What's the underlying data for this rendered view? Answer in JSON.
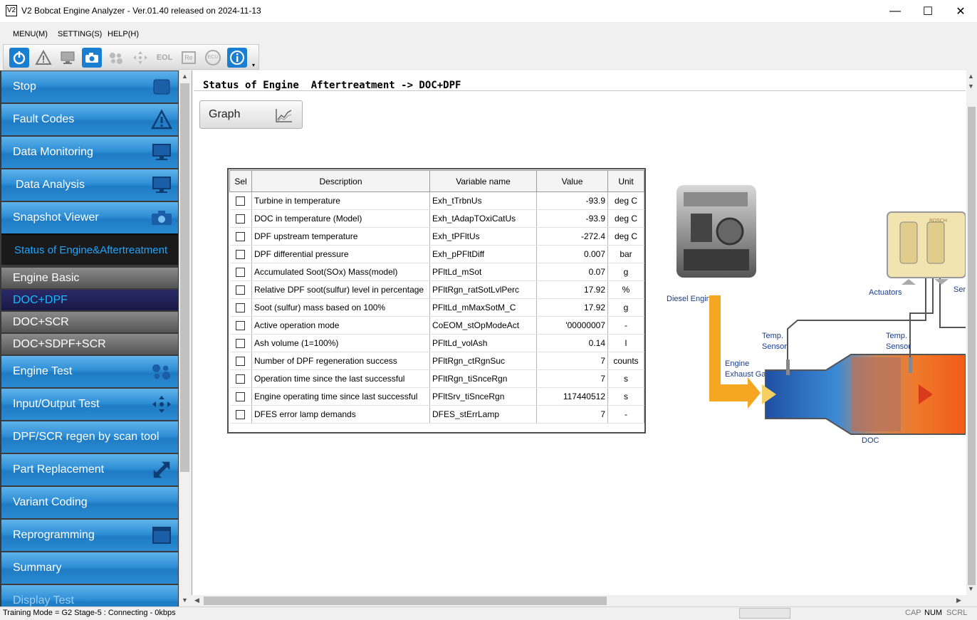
{
  "window": {
    "icon_text": "V2",
    "title": "V2 Bobcat Engine Analyzer - Ver.01.40 released on 2024-11-13",
    "minimize": "—",
    "maximize": "☐",
    "close": "✕"
  },
  "menu": {
    "items": [
      "MENU(M)",
      "SETTING(S)",
      "HELP(H)"
    ]
  },
  "toolbar": {
    "buttons": [
      "power-icon",
      "warning-icon",
      "monitor-icon",
      "camera-icon",
      "engine-test-icon",
      "io-arrows-icon",
      "eol-icon",
      "re-icon",
      "ecu-icon",
      "info-icon"
    ],
    "eol_label": "EOL",
    "re_label": "Re",
    "ecu_label": "ECU"
  },
  "sidebar": {
    "stop": "Stop",
    "fault_codes": "Fault Codes",
    "data_monitoring": "Data Monitoring",
    "data_analysis": "Data Analysis",
    "snapshot_viewer": "Snapshot Viewer",
    "status_header": "Status of Engine&Aftertreatment",
    "engine_basic": "Engine Basic",
    "doc_dpf": "DOC+DPF",
    "doc_scr": "DOC+SCR",
    "doc_sdpf_scr": "DOC+SDPF+SCR",
    "engine_test": "Engine Test",
    "io_test": "Input/Output Test",
    "regen": "DPF/SCR regen by scan tool",
    "part_replacement": "Part Replacement",
    "variant_coding": "Variant Coding",
    "reprogramming": "Reprogramming",
    "summary": "Summary",
    "display_test": "Display Test"
  },
  "content": {
    "title": "Status of Engine  Aftertreatment -> DOC+DPF",
    "graph_button": "Graph",
    "table": {
      "headers": [
        "Sel",
        "Description",
        "Variable name",
        "Value",
        "Unit"
      ],
      "rows": [
        {
          "desc": "Turbine in temperature",
          "var": "Exh_tTrbnUs",
          "value": "-93.9",
          "unit": "deg C"
        },
        {
          "desc": "DOC in temperature (Model)",
          "var": "Exh_tAdapTOxiCatUs",
          "value": "-93.9",
          "unit": "deg C"
        },
        {
          "desc": "DPF upstream temperature",
          "var": "Exh_tPFltUs",
          "value": "-272.4",
          "unit": "deg C"
        },
        {
          "desc": "DPF differential pressure",
          "var": "Exh_pPFltDiff",
          "value": "0.007",
          "unit": "bar"
        },
        {
          "desc": "Accumulated Soot(SOx) Mass(model)",
          "var": "PFltLd_mSot",
          "value": "0.07",
          "unit": "g"
        },
        {
          "desc": "Relative DPF soot(sulfur) level in percentage",
          "var": "PFltRgn_ratSotLvlPerc",
          "value": "17.92",
          "unit": "%"
        },
        {
          "desc": "Soot (sulfur) mass based on 100%",
          "var": "PFltLd_mMaxSotM_C",
          "value": "17.92",
          "unit": "g"
        },
        {
          "desc": "Active operation mode",
          "var": "CoEOM_stOpModeAct",
          "value": "'00000007",
          "unit": "-"
        },
        {
          "desc": "Ash volume (1=100%)",
          "var": "PFltLd_volAsh",
          "value": "0.14",
          "unit": "l"
        },
        {
          "desc": "Number of DPF regeneration success",
          "var": "PFltRgn_ctRgnSuc",
          "value": "7",
          "unit": "counts"
        },
        {
          "desc": "Operation time since the last successful",
          "var": "PFltRgn_tiSnceRgn",
          "value": "7",
          "unit": "s"
        },
        {
          "desc": "Engine operating time since last successful",
          "var": "PFltSrv_tiSnceRgn",
          "value": "117440512",
          "unit": "s"
        },
        {
          "desc": "DFES error lamp demands",
          "var": "DFES_stErrLamp",
          "value": "7",
          "unit": "-"
        }
      ]
    },
    "diagram": {
      "diesel_engine": "Diesel Engine",
      "actuators": "Actuators",
      "sensors_partial": "Sen",
      "temp_sensor_1": "Temp.",
      "temp_sensor_1b": "Sensor",
      "temp_sensor_2": "Temp.",
      "temp_sensor_2b": "Sensor",
      "exhaust_1": "Engine",
      "exhaust_2": "Exhaust Gas",
      "doc": "DOC",
      "ecu_brand": "BOSCH"
    }
  },
  "status": {
    "text": "Training Mode = G2 Stage-5 : Connecting - 0kbps",
    "cap": "CAP",
    "num": "NUM",
    "scrl": "SCRL"
  },
  "colors": {
    "nav_blue": "#2a8ad2",
    "active_text": "#19b9ff",
    "exhaust_orange": "#f5a623"
  }
}
